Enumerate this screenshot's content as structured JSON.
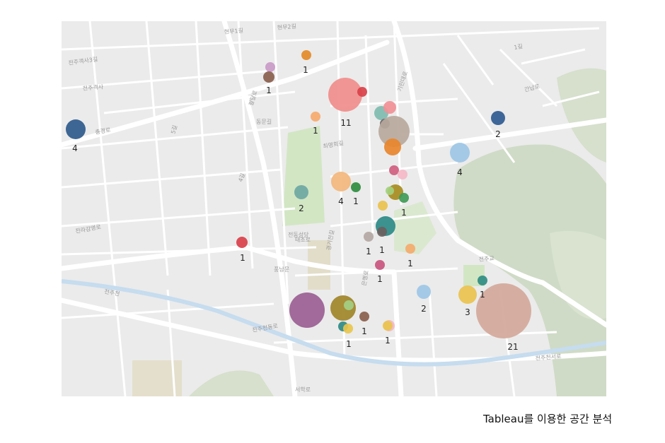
{
  "caption": "Tableau를 이용한 공간 분석",
  "colors": {
    "map_bg": "#ebebeb",
    "road": "#ffffff",
    "park": "#d4e6c8",
    "stream": "#c6dcef",
    "hill": "#cfdbc6"
  },
  "street_labels": [
    "전주객사3길",
    "충경로",
    "팔달로",
    "전라감영로",
    "전주천",
    "기린대로",
    "전주천서로",
    "전주천동로",
    "서학로",
    "풍남문",
    "동문길",
    "현무1길",
    "현무2길",
    "간납로",
    "태조로",
    "경기전길",
    "은행로",
    "최명희길",
    "전동성당",
    "전주객사",
    "4길",
    "5길",
    "전주교",
    "1길"
  ],
  "markers": [
    {
      "count": "4",
      "color": "#2e5a8c"
    },
    {
      "count": "1",
      "color": "#e38a27"
    },
    {
      "count": "",
      "color": "#c99ac7"
    },
    {
      "count": "1",
      "color": "#8a5e4c"
    },
    {
      "count": "11",
      "color": "#f08d8b"
    },
    {
      "count": "",
      "color": "#d9414a"
    },
    {
      "count": "1",
      "color": "#f6a96b"
    },
    {
      "count": "",
      "color": "#7fbbb0"
    },
    {
      "count": "",
      "color": "#f19096"
    },
    {
      "count": "",
      "color": "#6d6568"
    },
    {
      "count": "",
      "color": "#b9a89d"
    },
    {
      "count": "",
      "color": "#e8862c"
    },
    {
      "count": "2",
      "color": "#2f5a90"
    },
    {
      "count": "4",
      "color": "#9cc6e6"
    },
    {
      "count": "",
      "color": "#cf5e7f"
    },
    {
      "count": "",
      "color": "#f4b9c6"
    },
    {
      "count": "2",
      "color": "#6da8a2"
    },
    {
      "count": "4",
      "color": "#f3b67c"
    },
    {
      "count": "1",
      "color": "#2f8c3e"
    },
    {
      "count": "",
      "color": "#a78b1e"
    },
    {
      "count": "",
      "color": "#a3d07d"
    },
    {
      "count": "1",
      "color": "#3f9a56"
    },
    {
      "count": "",
      "color": "#e9c14c"
    },
    {
      "count": "",
      "color": "#2b8a87"
    },
    {
      "count": "1",
      "color": "#6b6060"
    },
    {
      "count": "1",
      "color": "#b3a7a2"
    },
    {
      "count": "1",
      "color": "#d9404a"
    },
    {
      "count": "1",
      "color": "#f4aa6d"
    },
    {
      "count": "1",
      "color": "#c9557e"
    },
    {
      "count": "1",
      "color": "#2f8c82"
    },
    {
      "count": "3",
      "color": "#e9c24e"
    },
    {
      "count": "2",
      "color": "#9cc6e6"
    },
    {
      "count": "21",
      "color": "#d3a89a"
    },
    {
      "count": "",
      "color": "#9a5e92"
    },
    {
      "count": "",
      "color": "#a08428"
    },
    {
      "count": "",
      "color": "#a4cf85"
    },
    {
      "count": "",
      "color": "#2e8a86"
    },
    {
      "count": "1",
      "color": "#e8c54c"
    },
    {
      "count": "1",
      "color": "#8a5e4c"
    },
    {
      "count": "",
      "color": "#f3b7c8"
    },
    {
      "count": "1",
      "color": "#e9c44c"
    }
  ]
}
